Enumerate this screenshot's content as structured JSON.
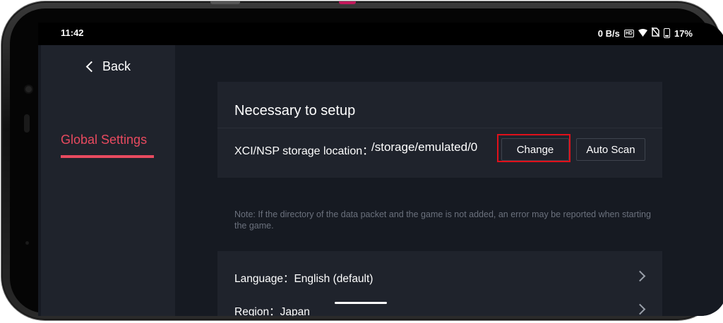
{
  "status": {
    "time": "11:42",
    "net_speed": "0 B/s",
    "hd_label": "HD",
    "battery": "17%"
  },
  "sidebar": {
    "back_label": "Back",
    "items": [
      {
        "label": "Global Settings",
        "active": true
      }
    ]
  },
  "setup": {
    "title": "Necessary to setup",
    "storage_label": "XCI/NSP storage location：",
    "storage_value": "/storage/emulated/0",
    "change_label": "Change",
    "auto_scan_label": "Auto Scan"
  },
  "note": "Note: If the directory of the data packet and the game is not added, an error may be reported when starting the game.",
  "settings": [
    {
      "label": "Language：English (default)"
    },
    {
      "label": "Region：Japan"
    }
  ],
  "colors": {
    "accent": "#e84a5f",
    "highlight": "#e0101a",
    "background": "#161a22",
    "panel": "#1f232c"
  }
}
